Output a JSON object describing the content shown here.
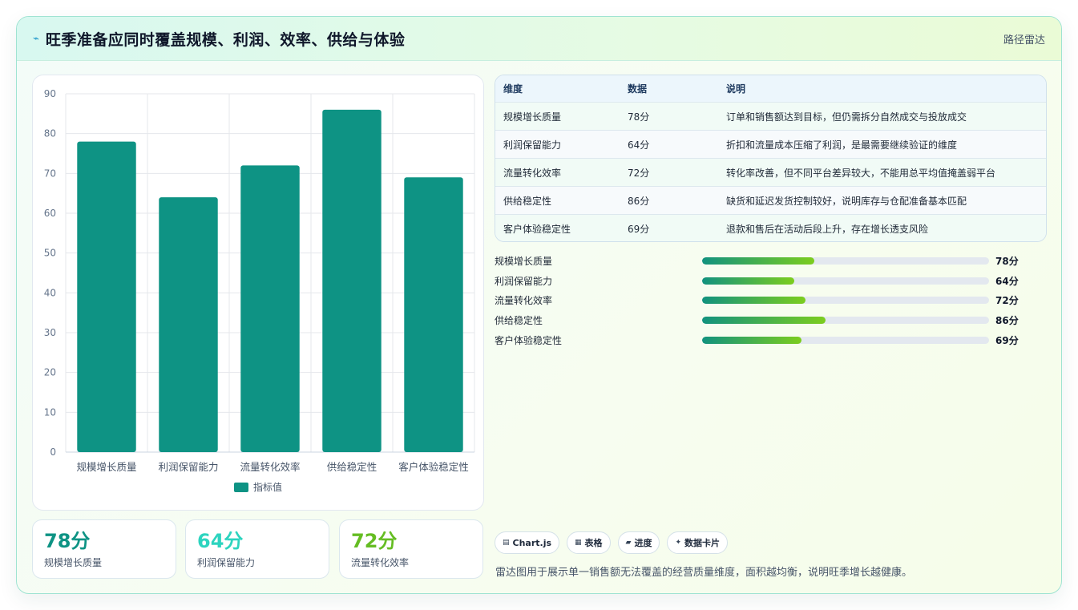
{
  "header": {
    "title": "旺季准备应同时覆盖规模、利润、效率、供给与体验",
    "tag": "路径雷达"
  },
  "chart_data": {
    "type": "bar",
    "categories": [
      "规模增长质量",
      "利润保留能力",
      "流量转化效率",
      "供给稳定性",
      "客户体验稳定性"
    ],
    "series": [
      {
        "name": "指标值",
        "values": [
          78,
          64,
          72,
          86,
          69
        ]
      }
    ],
    "ylim": [
      0,
      90
    ],
    "yticks": [
      0,
      10,
      20,
      30,
      40,
      50,
      60,
      70,
      80,
      90
    ],
    "grid": true,
    "legend": "bottom",
    "color": "#0e9384"
  },
  "stats": [
    {
      "value": "78分",
      "label": "规模增长质量",
      "color": "#0e9384"
    },
    {
      "value": "64分",
      "label": "利润保留能力",
      "color": "#2dd4bf"
    },
    {
      "value": "72分",
      "label": "流量转化效率",
      "color": "#65bd23"
    }
  ],
  "table": {
    "headers": [
      "维度",
      "数据",
      "说明"
    ],
    "rows": [
      [
        "规模增长质量",
        "78分",
        "订单和销售额达到目标，但仍需拆分自然成交与投放成交"
      ],
      [
        "利润保留能力",
        "64分",
        "折扣和流量成本压缩了利润，是最需要继续验证的维度"
      ],
      [
        "流量转化效率",
        "72分",
        "转化率改善，但不同平台差异较大，不能用总平均值掩盖弱平台"
      ],
      [
        "供给稳定性",
        "86分",
        "缺货和延迟发货控制较好，说明库存与仓配准备基本匹配"
      ],
      [
        "客户体验稳定性",
        "69分",
        "退款和售后在活动后段上升，存在增长透支风险"
      ]
    ]
  },
  "progress": [
    {
      "label": "规模增长质量",
      "value": 78,
      "text": "78分"
    },
    {
      "label": "利润保留能力",
      "value": 64,
      "text": "64分"
    },
    {
      "label": "流量转化效率",
      "value": 72,
      "text": "72分"
    },
    {
      "label": "供给稳定性",
      "value": 86,
      "text": "86分"
    },
    {
      "label": "客户体验稳定性",
      "value": 69,
      "text": "69分"
    }
  ],
  "progress_max": 200,
  "chips": [
    {
      "icon": "chart-icon",
      "glyph": "▤",
      "label": "Chart.js"
    },
    {
      "icon": "table-icon",
      "glyph": "▦",
      "label": "表格"
    },
    {
      "icon": "progress-icon",
      "glyph": "▰",
      "label": "进度"
    },
    {
      "icon": "sparkle-icon",
      "glyph": "✦",
      "label": "数据卡片"
    }
  ],
  "note": "雷达图用于展示单一销售额无法覆盖的经营质量维度，面积越均衡，说明旺季增长越健康。"
}
